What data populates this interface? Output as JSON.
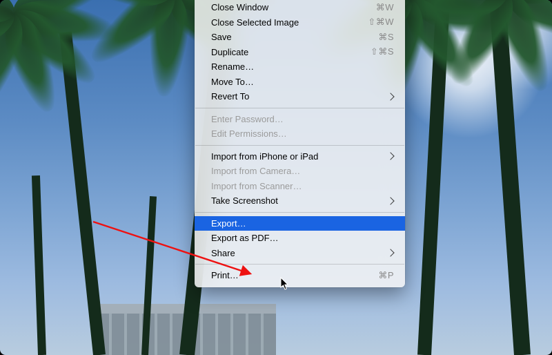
{
  "menu": {
    "items": [
      {
        "label": "Close Window",
        "shortcut": "⌘W"
      },
      {
        "label": "Close Selected Image",
        "shortcut": "⇧⌘W"
      },
      {
        "label": "Save",
        "shortcut": "⌘S"
      },
      {
        "label": "Duplicate",
        "shortcut": "⇧⌘S"
      },
      {
        "label": "Rename…"
      },
      {
        "label": "Move To…"
      },
      {
        "label": "Revert To",
        "submenu": true
      },
      {
        "label": "Enter Password…",
        "disabled": true
      },
      {
        "label": "Edit Permissions…",
        "disabled": true
      },
      {
        "label": "Import from iPhone or iPad",
        "submenu": true
      },
      {
        "label": "Import from Camera…",
        "disabled": true
      },
      {
        "label": "Import from Scanner…",
        "disabled": true
      },
      {
        "label": "Take Screenshot",
        "submenu": true
      },
      {
        "label": "Export…",
        "selected": true
      },
      {
        "label": "Export as PDF…"
      },
      {
        "label": "Share",
        "submenu": true
      },
      {
        "label": "Print…",
        "shortcut": "⌘P"
      }
    ]
  }
}
